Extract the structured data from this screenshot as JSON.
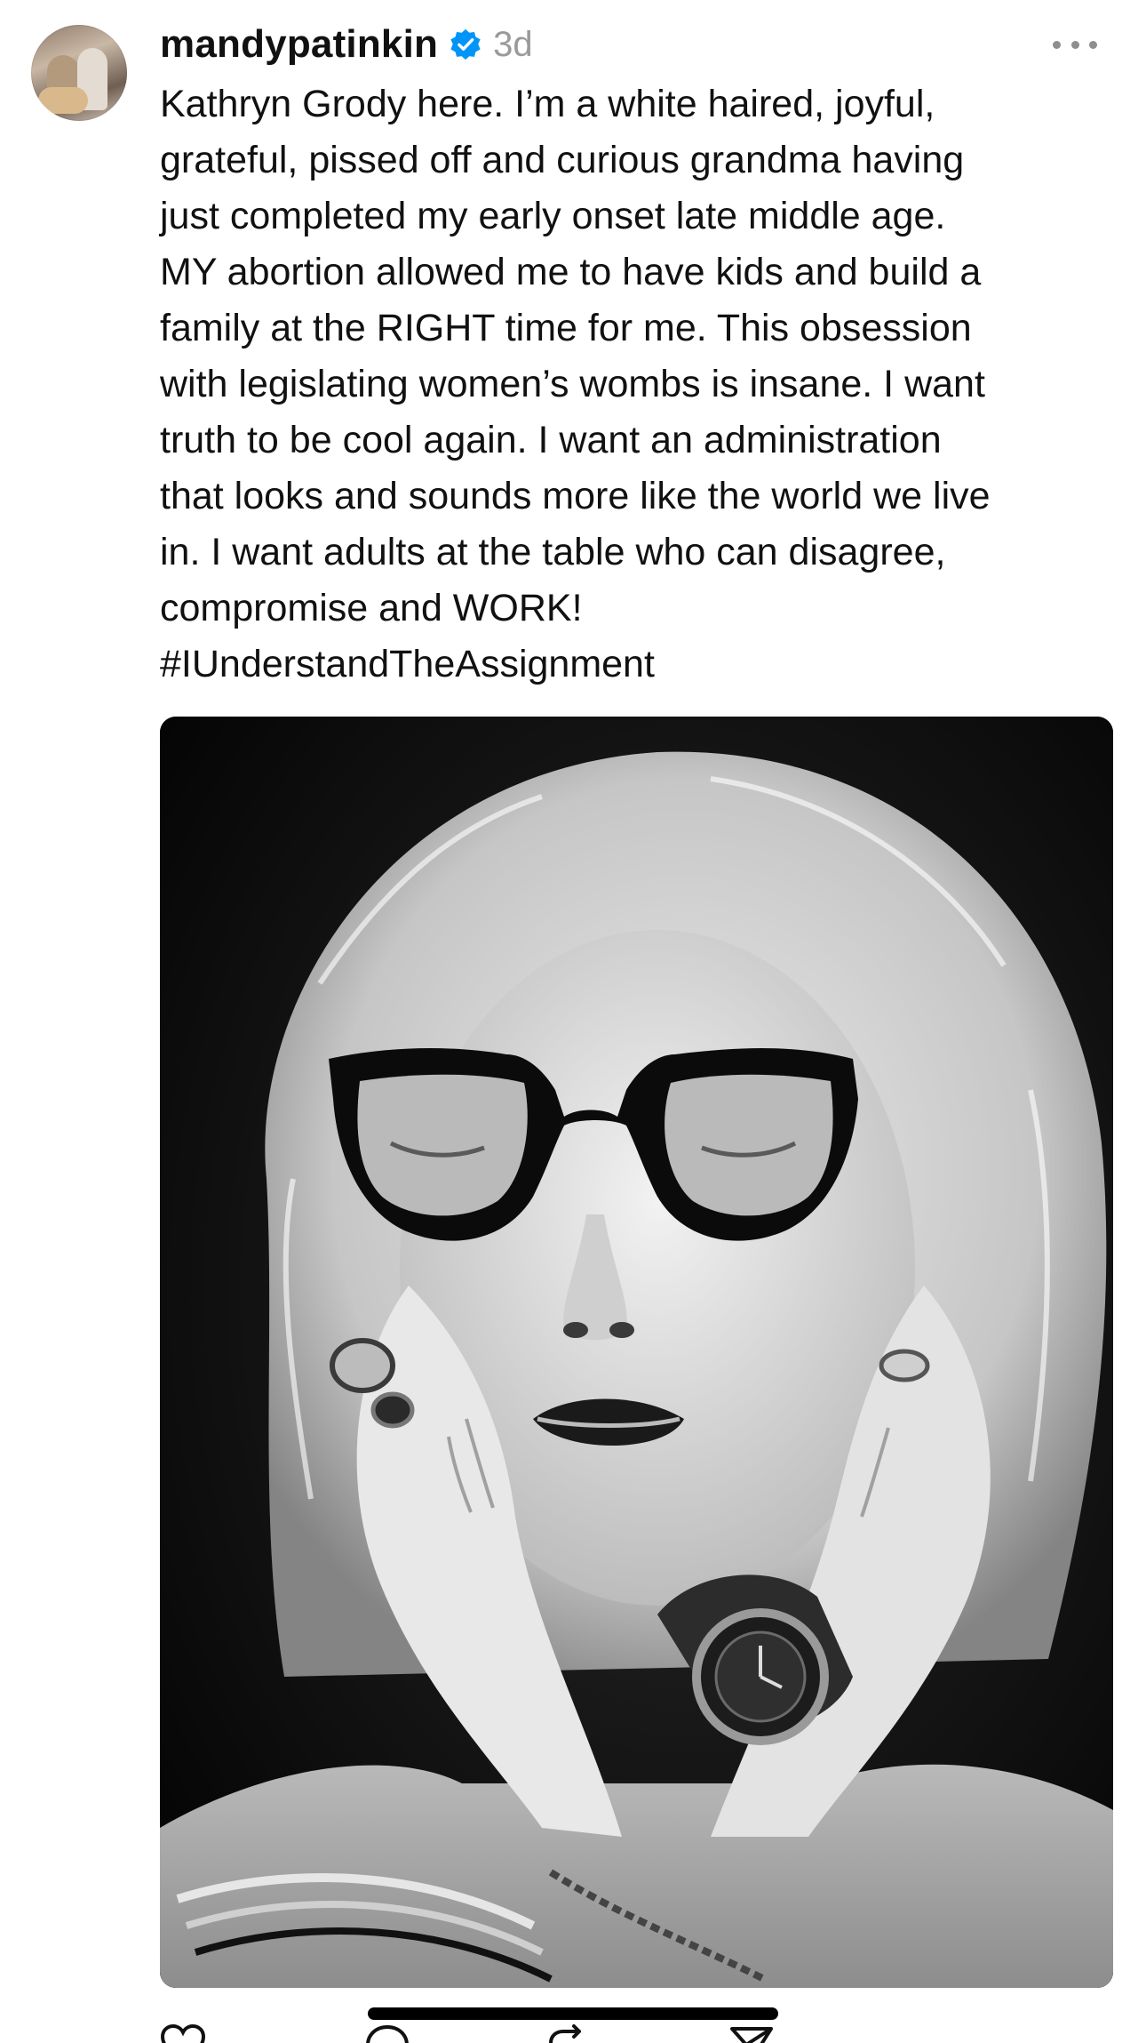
{
  "post": {
    "username": "mandypatinkin",
    "timestamp": "3d",
    "caption_lines": [
      "Kathryn Grody here. I’m a white haired, joyful,",
      "grateful, pissed off and curious grandma having",
      "just completed my early onset late middle age.",
      "MY abortion allowed me to have kids and build a",
      "family at the RIGHT time for me. This obsession",
      "with legislating women’s wombs is insane. I want",
      "truth to be cool again. I want an administration",
      "that looks and sounds more like the world we live",
      "in. I want adults at the table who can disagree,",
      "compromise and WORK!",
      "#IUnderstandTheAssignment"
    ],
    "icons": {
      "avatar": "avatar",
      "verified": "verified-badge-icon",
      "more": "more-options-icon",
      "like": "heart-icon",
      "reply": "comment-icon",
      "repost": "repost-icon",
      "share": "send-icon"
    },
    "actions": {
      "like_count": "",
      "reply_count": "",
      "repost_count": "",
      "share_count": ""
    }
  },
  "colors": {
    "verified_blue": "#0095F6",
    "text": "#111111",
    "secondary": "#9A9A9A"
  }
}
